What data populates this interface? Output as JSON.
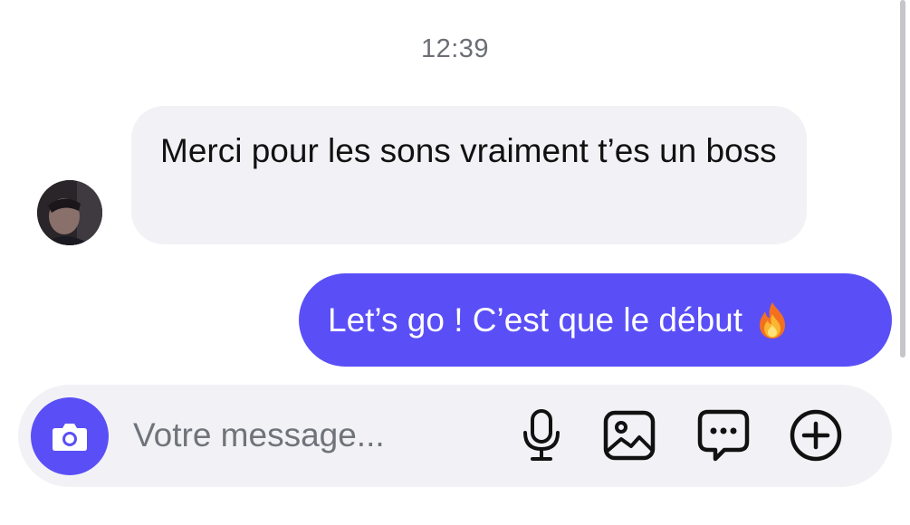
{
  "conversation": {
    "timestamp": "12:39",
    "messages": [
      {
        "direction": "incoming",
        "text": "Merci pour les sons vraiment t’es un boss",
        "has_avatar": true
      },
      {
        "direction": "outgoing",
        "text": "Let’s go ! C’est que le début",
        "emoji": "fire-emoji"
      }
    ]
  },
  "composer": {
    "placeholder": "Votre message...",
    "value": "",
    "camera_icon": "camera-icon",
    "tools": [
      "microphone-icon",
      "image-icon",
      "chat-bubble-icon",
      "plus-circle-icon"
    ]
  },
  "colors": {
    "accent": "#5a4ff6",
    "incoming_bubble": "#f2f2f6",
    "composer_bg": "#f2f2f6",
    "timestamp_text": "#6b6e75"
  }
}
